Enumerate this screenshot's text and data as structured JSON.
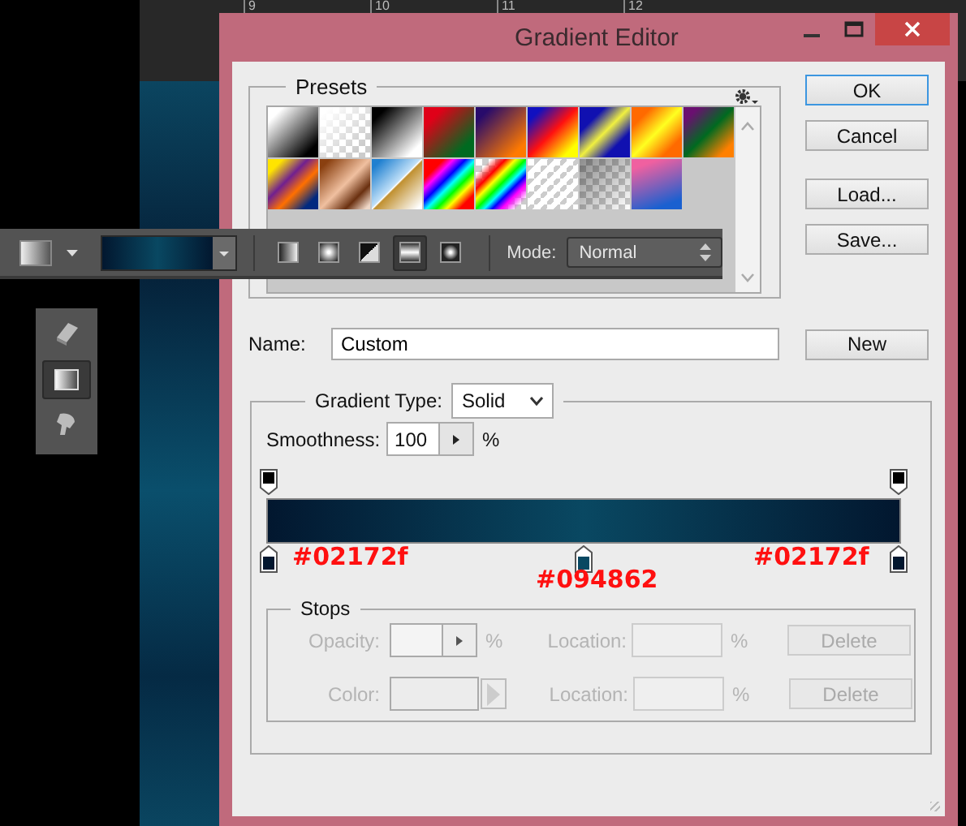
{
  "ruler": {
    "labels": [
      "9",
      "10",
      "11",
      "12"
    ]
  },
  "options_bar": {
    "type_buttons": [
      {
        "kind": "linear",
        "selected": false
      },
      {
        "kind": "radial",
        "selected": false
      },
      {
        "kind": "angle",
        "selected": false
      },
      {
        "kind": "reflected",
        "selected": true
      },
      {
        "kind": "diamond",
        "selected": false
      }
    ],
    "mode_label": "Mode:",
    "mode_value": "Normal"
  },
  "tools": [
    {
      "kind": "eraser",
      "selected": false
    },
    {
      "kind": "gradient",
      "selected": true
    },
    {
      "kind": "bucket",
      "selected": false
    }
  ],
  "dialog": {
    "title": "Gradient Editor",
    "presets": {
      "label": "Presets",
      "swatches": [
        {
          "kind": "white-black"
        },
        {
          "kind": "white-transparent"
        },
        {
          "kind": "black-white"
        },
        {
          "kind": "red-green"
        },
        {
          "kind": "violet-orange"
        },
        {
          "kind": "blue-red-yellow"
        },
        {
          "kind": "blue-yellow-blue"
        },
        {
          "kind": "orange-yellow-orange"
        },
        {
          "kind": "violet-green-orange"
        },
        {
          "kind": "yellow-violet-orange-blue"
        },
        {
          "kind": "copper"
        },
        {
          "kind": "chrome"
        },
        {
          "kind": "spectrum"
        },
        {
          "kind": "transparent-rainbow"
        },
        {
          "kind": "transparent-stripes"
        },
        {
          "kind": "neutral-density"
        },
        {
          "kind": "pink-blue"
        }
      ]
    },
    "buttons": [
      {
        "label": "OK",
        "default": true
      },
      {
        "label": "Cancel",
        "default": false
      },
      {
        "label": "Load...",
        "default": false
      },
      {
        "label": "Save...",
        "default": false
      }
    ],
    "name_label": "Name:",
    "name_value": "Custom",
    "new_button": "New",
    "gradient_type_label": "Gradient Type:",
    "gradient_type_value": "Solid",
    "smoothness_label": "Smoothness:",
    "smoothness_value": "100",
    "smoothness_unit": "%",
    "opacity_stops": [
      {
        "color": "#000000"
      },
      {
        "color": "#000000"
      }
    ],
    "color_stops": [
      {
        "color": "#02172f"
      },
      {
        "color": "#094862"
      },
      {
        "color": "#02172f"
      }
    ],
    "annotations": [
      "#02172f",
      "#094862",
      "#02172f"
    ],
    "stops": {
      "label": "Stops",
      "rows": [
        {
          "kind": "opacity",
          "label": "Opacity:",
          "unit": "%",
          "location_label": "Location:",
          "location_unit": "%",
          "delete": "Delete",
          "disabled": true
        },
        {
          "kind": "color",
          "label": "Color:",
          "location_label": "Location:",
          "location_unit": "%",
          "delete": "Delete",
          "disabled": true
        }
      ]
    }
  }
}
